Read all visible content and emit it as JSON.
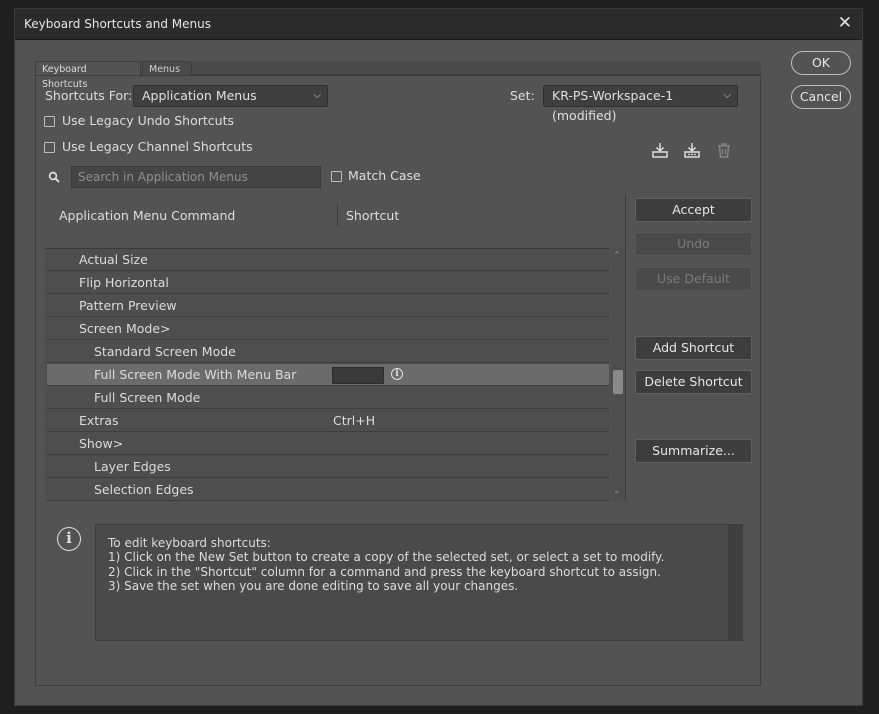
{
  "window": {
    "title": "Keyboard Shortcuts and Menus",
    "close_glyph": "✕"
  },
  "dialog_buttons": {
    "ok": "OK",
    "cancel": "Cancel"
  },
  "tabs": [
    {
      "label": "Keyboard Shortcuts",
      "active": true
    },
    {
      "label": "Menus",
      "active": false
    }
  ],
  "shortcuts_for": {
    "label": "Shortcuts For:",
    "value": "Application Menus"
  },
  "set": {
    "label": "Set:",
    "value": "KR-PS-Workspace-1 (modified)"
  },
  "options": {
    "legacy_undo": {
      "label": "Use Legacy Undo Shortcuts",
      "checked": false
    },
    "legacy_channel": {
      "label": "Use Legacy Channel Shortcuts",
      "checked": false
    },
    "match_case": {
      "label": "Match Case",
      "checked": false
    }
  },
  "search": {
    "placeholder": "Search in Application Menus",
    "value": ""
  },
  "icons": {
    "save_set": "save-set-icon",
    "save_set_as": "save-set-as-icon",
    "delete_set": "trash-icon",
    "search": "search-icon",
    "info": "info-icon"
  },
  "columns": {
    "command": "Application Menu Command",
    "shortcut": "Shortcut"
  },
  "rows": [
    {
      "command": "Actual Size",
      "shortcut": "",
      "indent": 1
    },
    {
      "command": "Flip Horizontal",
      "shortcut": "",
      "indent": 1
    },
    {
      "command": "Pattern Preview",
      "shortcut": "",
      "indent": 1
    },
    {
      "command": "Screen Mode>",
      "shortcut": "",
      "indent": 1
    },
    {
      "command": "Standard Screen Mode",
      "shortcut": "",
      "indent": 2
    },
    {
      "command": "Full Screen Mode With Menu Bar",
      "shortcut": "",
      "indent": 2,
      "selected": true,
      "editing": true
    },
    {
      "command": "Full Screen Mode",
      "shortcut": "",
      "indent": 2
    },
    {
      "command": "Extras",
      "shortcut": "Ctrl+H",
      "indent": 1
    },
    {
      "command": "Show>",
      "shortcut": "",
      "indent": 1
    },
    {
      "command": "Layer Edges",
      "shortcut": "",
      "indent": 2
    },
    {
      "command": "Selection Edges",
      "shortcut": "",
      "indent": 2
    }
  ],
  "side_buttons": {
    "accept": "Accept",
    "undo": "Undo",
    "use_default": "Use Default",
    "add_shortcut": "Add Shortcut",
    "delete_shortcut": "Delete Shortcut",
    "summarize": "Summarize..."
  },
  "help_text": {
    "line1": "To edit keyboard shortcuts:",
    "line2": "1) Click on the New Set button to create a copy of the selected set, or select a set to modify.",
    "line3": "2) Click in the \"Shortcut\" column for a command and press the keyboard shortcut to assign.",
    "line4": "3) Save the set when you are done editing to save all your changes."
  },
  "colors": {
    "window_bg": "#535353",
    "titlebar_bg": "#2b2b2b",
    "selected_row": "#6b6b6b"
  }
}
